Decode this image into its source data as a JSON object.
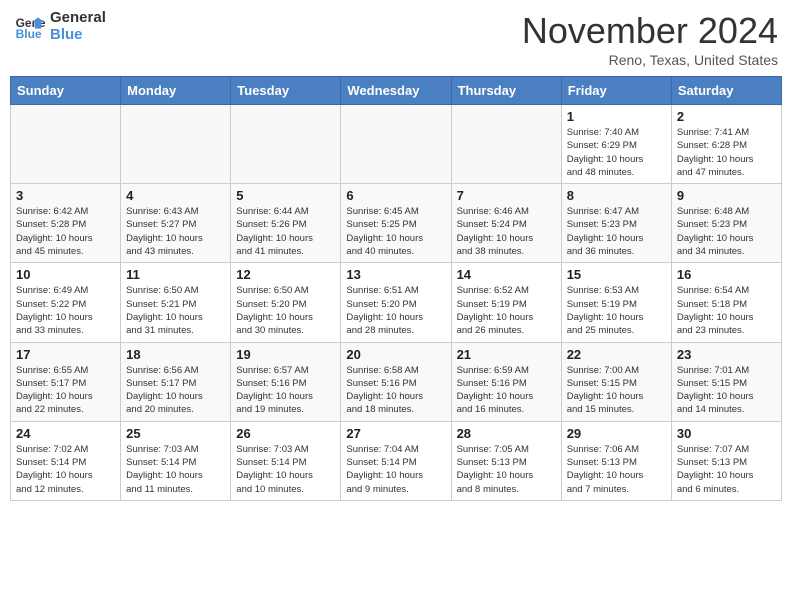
{
  "header": {
    "logo_line1": "General",
    "logo_line2": "Blue",
    "month_title": "November 2024",
    "location": "Reno, Texas, United States"
  },
  "weekdays": [
    "Sunday",
    "Monday",
    "Tuesday",
    "Wednesday",
    "Thursday",
    "Friday",
    "Saturday"
  ],
  "weeks": [
    [
      {
        "day": "",
        "info": ""
      },
      {
        "day": "",
        "info": ""
      },
      {
        "day": "",
        "info": ""
      },
      {
        "day": "",
        "info": ""
      },
      {
        "day": "",
        "info": ""
      },
      {
        "day": "1",
        "info": "Sunrise: 7:40 AM\nSunset: 6:29 PM\nDaylight: 10 hours\nand 48 minutes."
      },
      {
        "day": "2",
        "info": "Sunrise: 7:41 AM\nSunset: 6:28 PM\nDaylight: 10 hours\nand 47 minutes."
      }
    ],
    [
      {
        "day": "3",
        "info": "Sunrise: 6:42 AM\nSunset: 5:28 PM\nDaylight: 10 hours\nand 45 minutes."
      },
      {
        "day": "4",
        "info": "Sunrise: 6:43 AM\nSunset: 5:27 PM\nDaylight: 10 hours\nand 43 minutes."
      },
      {
        "day": "5",
        "info": "Sunrise: 6:44 AM\nSunset: 5:26 PM\nDaylight: 10 hours\nand 41 minutes."
      },
      {
        "day": "6",
        "info": "Sunrise: 6:45 AM\nSunset: 5:25 PM\nDaylight: 10 hours\nand 40 minutes."
      },
      {
        "day": "7",
        "info": "Sunrise: 6:46 AM\nSunset: 5:24 PM\nDaylight: 10 hours\nand 38 minutes."
      },
      {
        "day": "8",
        "info": "Sunrise: 6:47 AM\nSunset: 5:23 PM\nDaylight: 10 hours\nand 36 minutes."
      },
      {
        "day": "9",
        "info": "Sunrise: 6:48 AM\nSunset: 5:23 PM\nDaylight: 10 hours\nand 34 minutes."
      }
    ],
    [
      {
        "day": "10",
        "info": "Sunrise: 6:49 AM\nSunset: 5:22 PM\nDaylight: 10 hours\nand 33 minutes."
      },
      {
        "day": "11",
        "info": "Sunrise: 6:50 AM\nSunset: 5:21 PM\nDaylight: 10 hours\nand 31 minutes."
      },
      {
        "day": "12",
        "info": "Sunrise: 6:50 AM\nSunset: 5:20 PM\nDaylight: 10 hours\nand 30 minutes."
      },
      {
        "day": "13",
        "info": "Sunrise: 6:51 AM\nSunset: 5:20 PM\nDaylight: 10 hours\nand 28 minutes."
      },
      {
        "day": "14",
        "info": "Sunrise: 6:52 AM\nSunset: 5:19 PM\nDaylight: 10 hours\nand 26 minutes."
      },
      {
        "day": "15",
        "info": "Sunrise: 6:53 AM\nSunset: 5:19 PM\nDaylight: 10 hours\nand 25 minutes."
      },
      {
        "day": "16",
        "info": "Sunrise: 6:54 AM\nSunset: 5:18 PM\nDaylight: 10 hours\nand 23 minutes."
      }
    ],
    [
      {
        "day": "17",
        "info": "Sunrise: 6:55 AM\nSunset: 5:17 PM\nDaylight: 10 hours\nand 22 minutes."
      },
      {
        "day": "18",
        "info": "Sunrise: 6:56 AM\nSunset: 5:17 PM\nDaylight: 10 hours\nand 20 minutes."
      },
      {
        "day": "19",
        "info": "Sunrise: 6:57 AM\nSunset: 5:16 PM\nDaylight: 10 hours\nand 19 minutes."
      },
      {
        "day": "20",
        "info": "Sunrise: 6:58 AM\nSunset: 5:16 PM\nDaylight: 10 hours\nand 18 minutes."
      },
      {
        "day": "21",
        "info": "Sunrise: 6:59 AM\nSunset: 5:16 PM\nDaylight: 10 hours\nand 16 minutes."
      },
      {
        "day": "22",
        "info": "Sunrise: 7:00 AM\nSunset: 5:15 PM\nDaylight: 10 hours\nand 15 minutes."
      },
      {
        "day": "23",
        "info": "Sunrise: 7:01 AM\nSunset: 5:15 PM\nDaylight: 10 hours\nand 14 minutes."
      }
    ],
    [
      {
        "day": "24",
        "info": "Sunrise: 7:02 AM\nSunset: 5:14 PM\nDaylight: 10 hours\nand 12 minutes."
      },
      {
        "day": "25",
        "info": "Sunrise: 7:03 AM\nSunset: 5:14 PM\nDaylight: 10 hours\nand 11 minutes."
      },
      {
        "day": "26",
        "info": "Sunrise: 7:03 AM\nSunset: 5:14 PM\nDaylight: 10 hours\nand 10 minutes."
      },
      {
        "day": "27",
        "info": "Sunrise: 7:04 AM\nSunset: 5:14 PM\nDaylight: 10 hours\nand 9 minutes."
      },
      {
        "day": "28",
        "info": "Sunrise: 7:05 AM\nSunset: 5:13 PM\nDaylight: 10 hours\nand 8 minutes."
      },
      {
        "day": "29",
        "info": "Sunrise: 7:06 AM\nSunset: 5:13 PM\nDaylight: 10 hours\nand 7 minutes."
      },
      {
        "day": "30",
        "info": "Sunrise: 7:07 AM\nSunset: 5:13 PM\nDaylight: 10 hours\nand 6 minutes."
      }
    ]
  ]
}
